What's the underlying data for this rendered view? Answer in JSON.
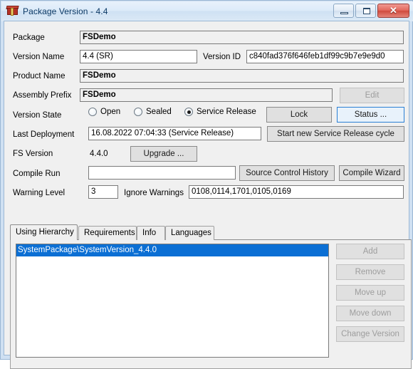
{
  "window": {
    "title": "Package Version - 4.4",
    "icon": "package-box-icon",
    "controls": {
      "minimize": "minimize-icon",
      "maximize": "maximize-icon",
      "close": "✕"
    }
  },
  "form": {
    "package": {
      "label": "Package",
      "value": "FSDemo"
    },
    "version_name": {
      "label": "Version Name",
      "value": "4.4 (SR)"
    },
    "version_id": {
      "label": "Version ID",
      "value": "c840fad376f646feb1df99c9b7e9e9d0"
    },
    "product_name": {
      "label": "Product Name",
      "value": "FSDemo"
    },
    "assembly_prefix": {
      "label": "Assembly Prefix",
      "value": "FSDemo",
      "edit_button": "Edit"
    },
    "version_state": {
      "label": "Version State",
      "options": [
        {
          "label": "Open",
          "checked": false
        },
        {
          "label": "Sealed",
          "checked": false
        },
        {
          "label": "Service Release",
          "checked": true
        }
      ],
      "lock_button": "Lock",
      "status_button": "Status ..."
    },
    "last_deployment": {
      "label": "Last Deployment",
      "value": "16.08.2022 07:04:33 (Service Release)",
      "cycle_button": "Start new Service Release cycle"
    },
    "fs_version": {
      "label": "FS Version",
      "value": "4.4.0",
      "upgrade_button": "Upgrade ..."
    },
    "compile_run": {
      "label": "Compile Run",
      "value": "",
      "source_control_button": "Source Control History",
      "compile_wizard_button": "Compile Wizard"
    },
    "warning_level": {
      "label": "Warning Level",
      "value": "3",
      "ignore_label": "Ignore Warnings",
      "ignore_value": "0108,0114,1701,0105,0169"
    }
  },
  "tabs": [
    {
      "label": "Using Hierarchy",
      "active": true
    },
    {
      "label": "Requirements",
      "active": false
    },
    {
      "label": "Info",
      "active": false
    },
    {
      "label": "Languages",
      "active": false
    }
  ],
  "hierarchy": {
    "items": [
      {
        "label": "SystemPackage\\SystemVersion_4.4.0",
        "selected": true
      }
    ],
    "buttons": [
      {
        "label": "Add",
        "disabled": true
      },
      {
        "label": "Remove",
        "disabled": true
      },
      {
        "label": "Move up",
        "disabled": true
      },
      {
        "label": "Move down",
        "disabled": true
      },
      {
        "label": "Change Version",
        "disabled": true
      }
    ]
  },
  "colors": {
    "frame": "#cfe0f2",
    "form_bg": "#f0f0f0",
    "selection": "#0b6fd4",
    "focus_border": "#2a7fd4",
    "close_button": "#cf4a3d"
  }
}
